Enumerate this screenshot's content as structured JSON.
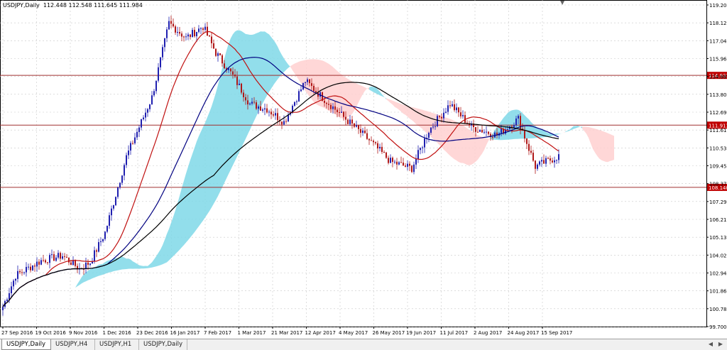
{
  "chart": {
    "info_text": "USDJPY,Daily  112.448 112.548 111.645 111.984",
    "price_labels": [
      "119.200",
      "118.120",
      "117.040",
      "115.960",
      "114.880",
      "113.800",
      "112.690",
      "111.610",
      "110.530",
      "109.450",
      "108.370",
      "107.290",
      "106.210",
      "105.130",
      "104.020",
      "102.940",
      "101.860",
      "100.780",
      "99.700"
    ],
    "date_labels": [
      "27 Sep 2016",
      "19 Oct 2016",
      "9 Nov 2016",
      "1 Dec 2016",
      "23 Dec 2016",
      "16 Jan 2017",
      "7 Feb 2017",
      "1 Mar 2017",
      "21 Mar 2017",
      "12 Apr 2017",
      "4 May 2017",
      "26 May 2017",
      "19 Jun 2017",
      "11 Jul 2017",
      "2 Aug 2017",
      "24 Aug 2017",
      "15 Sep 2017"
    ],
    "hlines": [
      {
        "price": 114.931,
        "label": "114.931"
      },
      {
        "price": 111.913,
        "label": "111.913"
      },
      {
        "price": 108.14,
        "label": "108.140"
      }
    ],
    "colors": {
      "bull_candle": "#2020b0",
      "bear_candle": "#b01818",
      "ma_fast": "#c01010",
      "ma_mid": "#000080",
      "ma_slow": "#000000",
      "cloud_bull": "#7fd8e8",
      "cloud_bear": "#ffd0d0",
      "hline": "#a03030",
      "hline_label_bg": "#c00000",
      "grid": "#c8c8c8"
    }
  },
  "tabs": [
    {
      "label": "USDJPY,Daily",
      "active": true
    },
    {
      "label": "USDJPY,H4",
      "active": false
    },
    {
      "label": "USDJPY,H1",
      "active": false
    },
    {
      "label": "USDJPY,Daily",
      "active": false
    }
  ]
}
